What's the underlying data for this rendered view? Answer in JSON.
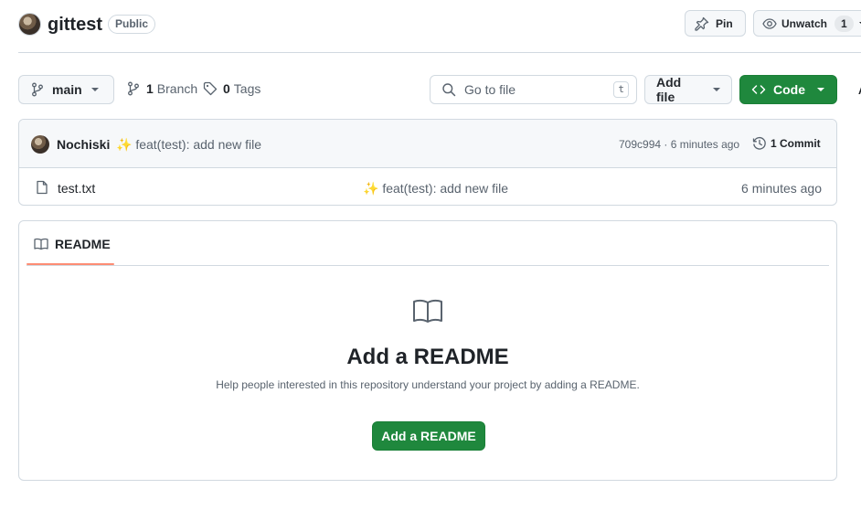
{
  "repo": {
    "name": "gittest",
    "visibility": "Public"
  },
  "header_actions": {
    "pin_label": "Pin",
    "watch_label": "Unwatch",
    "watch_count": "1"
  },
  "toolbar": {
    "branch_name": "main",
    "branch_count": "1",
    "branch_label": "Branch",
    "tag_count": "0",
    "tag_label": "Tags",
    "goto_placeholder": "Go to file",
    "goto_shortcut": "t",
    "add_file_label": "Add file",
    "code_label": "Code"
  },
  "latest_commit": {
    "author": "Nochiski",
    "emoji": "✨",
    "message": "feat(test): add new file",
    "meta": "709c994 · 6 minutes ago",
    "commit_count_label": "1 Commit"
  },
  "files": [
    {
      "name": "test.txt",
      "emoji": "✨",
      "message": "feat(test): add new file",
      "time": "6 minutes ago"
    }
  ],
  "readme": {
    "tab_label": "README",
    "title": "Add a README",
    "description": "Help people interested in this repository understand your project by adding a README.",
    "button_label": "Add a README"
  },
  "colors": {
    "primary_green": "#1f883d",
    "tab_underline": "#fd8c73",
    "border": "#d1d9e0"
  },
  "icons": [
    "repo-avatar",
    "pin-icon",
    "eye-icon",
    "branch-icon",
    "tag-icon",
    "search-icon",
    "code-icon",
    "history-icon",
    "file-icon",
    "book-icon"
  ]
}
